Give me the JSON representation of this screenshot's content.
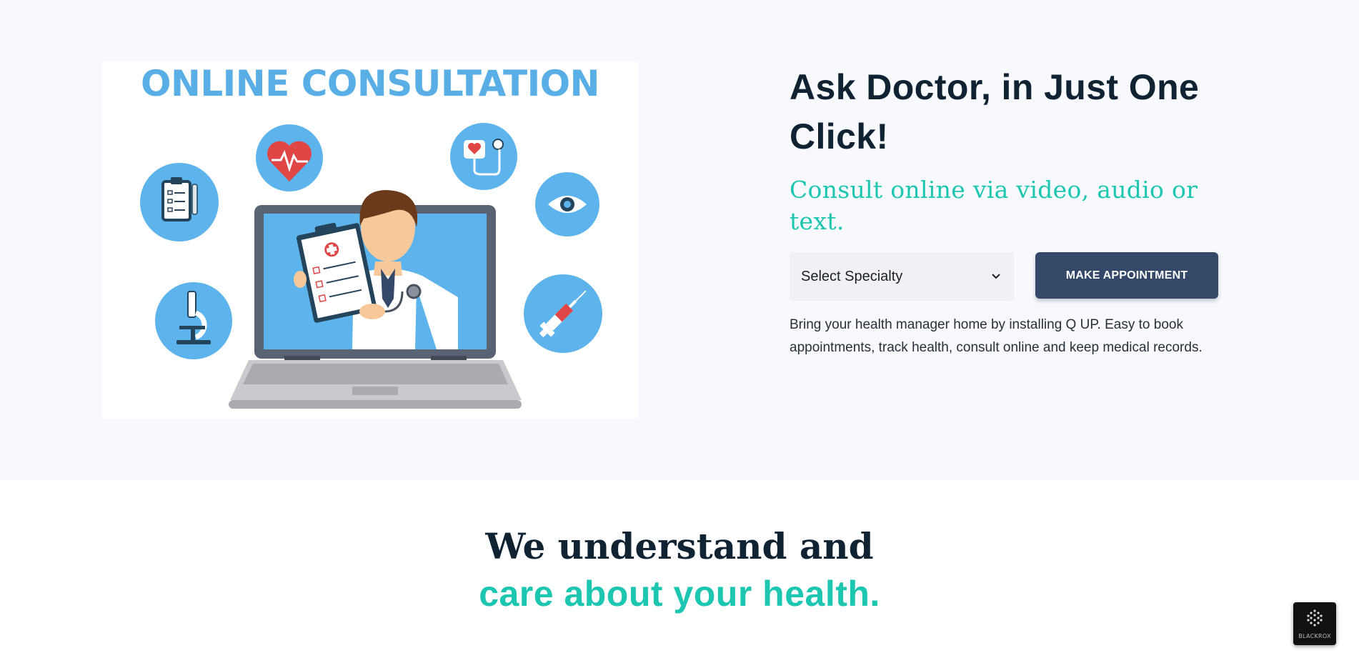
{
  "hero": {
    "illustration_title": "ONLINE CONSULTATION",
    "title": "Ask Doctor, in Just One Click!",
    "subtitle": "Consult online via video, audio or text.",
    "specialty_select": {
      "selected": "Select Specialty"
    },
    "appointment_button": "MAKE APPOINTMENT",
    "description": "Bring your health manager home by installing Q UP. Easy to book appointments, track health, consult online and keep medical records."
  },
  "section2": {
    "line1": "We understand and",
    "line2": "care about your health."
  },
  "badge": {
    "label": "BLACKROX"
  },
  "colors": {
    "navy": "#0f2333",
    "teal": "#1cc6b0",
    "button": "#344868",
    "icon_blue": "#5aaee6",
    "hero_bg": "#f7f9fd"
  }
}
